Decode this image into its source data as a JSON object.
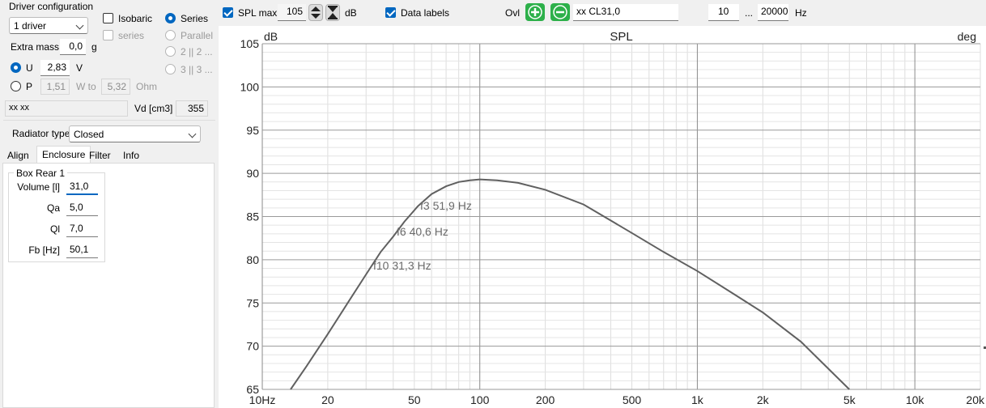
{
  "driver": {
    "group_title": "Driver configuration",
    "driver_count": "1 driver",
    "isobaric_label": "Isobaric",
    "series_sub_label": "series",
    "series_label": "Series",
    "parallel_label": "Parallel",
    "opt_2x2": "2 || 2 ...",
    "opt_3x3": "3 || 3 ...",
    "extra_mass_label": "Extra mass",
    "extra_mass_value": "0,0",
    "extra_mass_unit": "g",
    "u_label": "U",
    "u_value": "2,83",
    "u_unit": "V",
    "p_label": "P",
    "p_value": "1,51",
    "w_to_label": "W to",
    "w_to_value": "5,32",
    "ohm_label": "Ohm",
    "name_value": "xx xx",
    "vd_label": "Vd [cm3]",
    "vd_value": "355"
  },
  "radiator": {
    "label": "Radiator type",
    "value": "Closed"
  },
  "tabs": [
    "Align",
    "Enclosure",
    "Filter",
    "Info"
  ],
  "box": {
    "title": "Box Rear 1",
    "fields": [
      {
        "label": "Volume [l]",
        "value": "31,0"
      },
      {
        "label": "Qa",
        "value": "5,0"
      },
      {
        "label": "Ql",
        "value": "7,0"
      },
      {
        "label": "Fb [Hz]",
        "value": "50,1"
      }
    ]
  },
  "toolbar": {
    "spl_max_label": "SPL max",
    "spl_max_value": "105",
    "db_label": "dB",
    "data_labels_label": "Data labels",
    "ovl_label": "Ovl",
    "overlay_name": "xx CL31,0",
    "f_min": "10",
    "f_sep": "...",
    "f_max": "20000",
    "hz_label": "Hz"
  },
  "colors": {
    "accent": "#0067c0",
    "plus_button": "#2db04a",
    "curve": "#606060",
    "label_text": "#6a6a6a"
  },
  "chart_data": {
    "type": "line",
    "title": "SPL",
    "ylabel": "dB",
    "y2label": "deg",
    "xscale": "log",
    "xlim": [
      10,
      20000
    ],
    "ylim": [
      65,
      105
    ],
    "grid": true,
    "xticks": [
      "10Hz",
      "20",
      "50",
      "100",
      "200",
      "500",
      "1k",
      "2k",
      "5k",
      "10k",
      "20k"
    ],
    "yticks": [
      "105",
      "100",
      "95",
      "90",
      "85",
      "80",
      "75",
      "70",
      "65"
    ],
    "series": [
      {
        "x": [
          13.5,
          16,
          20,
          25,
          30,
          35,
          40,
          45,
          51.9,
          60,
          70,
          80,
          90,
          100,
          120,
          150,
          200,
          300,
          500,
          700,
          1000,
          1500,
          2000,
          3000,
          5000
        ],
        "y": [
          65,
          67.7,
          71.4,
          75.2,
          78.3,
          80.9,
          82.7,
          84.4,
          86.2,
          87.6,
          88.5,
          89.0,
          89.2,
          89.3,
          89.2,
          88.9,
          88.1,
          86.4,
          83.1,
          80.9,
          78.7,
          75.9,
          73.9,
          70.5,
          65
        ]
      }
    ],
    "annotations": [
      "f3 51,9 Hz",
      "f6 40,6 Hz",
      "f10 31,3 Hz"
    ]
  }
}
